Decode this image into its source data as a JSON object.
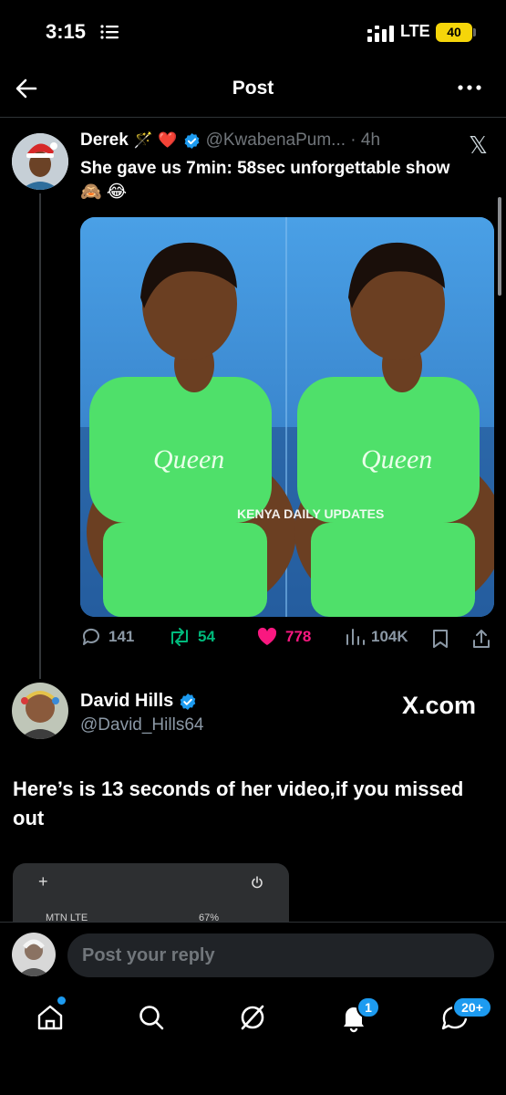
{
  "status_bar": {
    "time": "3:15",
    "network": "LTE",
    "battery": "40"
  },
  "header": {
    "title": "Post"
  },
  "tweet": {
    "name": "Derek",
    "name_emoji": "🪄 ❤️",
    "handle": "@KwabenaPum... · 4h",
    "text": "She gave us 7min: 58sec unforgettable show 🙈 😂",
    "image_watermark": "KENYA DAILY UPDATES",
    "shirt_text": "Queen",
    "actions": {
      "replies": "141",
      "reposts": "54",
      "likes": "778",
      "views": "104K"
    }
  },
  "quoted": {
    "name": "David Hills",
    "handle": "@David_Hills64",
    "site": "X.com",
    "text": "Here’s is 13 seconds of her video,if you missed out",
    "embed_carrier": "MTN LTE",
    "embed_battery": "67%"
  },
  "reply": {
    "placeholder": "Post your reply"
  },
  "tabbar": {
    "notifications_badge": "1",
    "messages_badge": "20+"
  },
  "colors": {
    "accent": "#1d9bf0",
    "like": "#f91880",
    "repost": "#00ba7c",
    "muted": "#71767b"
  }
}
